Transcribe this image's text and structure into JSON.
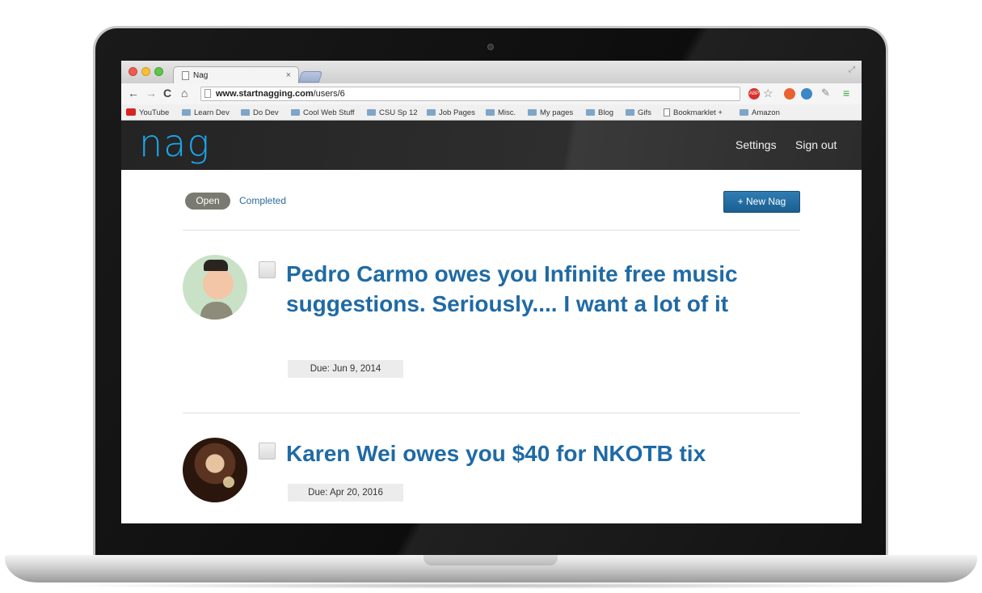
{
  "browser": {
    "tab_title": "Nag",
    "tab_close": "×",
    "url_host": "www.startnagging.com",
    "url_path": "/users/6",
    "bookmarks": [
      "YouTube",
      "Learn Dev",
      "Do Dev",
      "Cool Web Stuff",
      "CSU Sp 12",
      "Job Pages",
      "Misc.",
      "My pages",
      "Blog",
      "Gifs",
      "Bookmarklet +",
      "Amazon"
    ],
    "ext_abp_label": "ABP"
  },
  "header": {
    "logo": "nag",
    "settings_label": "Settings",
    "signout_label": "Sign out"
  },
  "filters": {
    "open_label": "Open",
    "completed_label": "Completed",
    "active": "Open"
  },
  "new_nag_label": "+ New Nag",
  "nags": [
    {
      "title": "Pedro Carmo owes you Infinite free music suggestions. Seriously.... I want a lot of it",
      "due": "Due: Jun 9, 2014",
      "checked": false
    },
    {
      "title": "Karen Wei owes you $40 for NKOTB tix",
      "due": "Due: Apr 20, 2016",
      "checked": false
    }
  ],
  "colors": {
    "accent": "#1aa7ec",
    "link": "#1f6aa5",
    "button": "#1a5f91",
    "header_bg": "#2a2a2a"
  }
}
